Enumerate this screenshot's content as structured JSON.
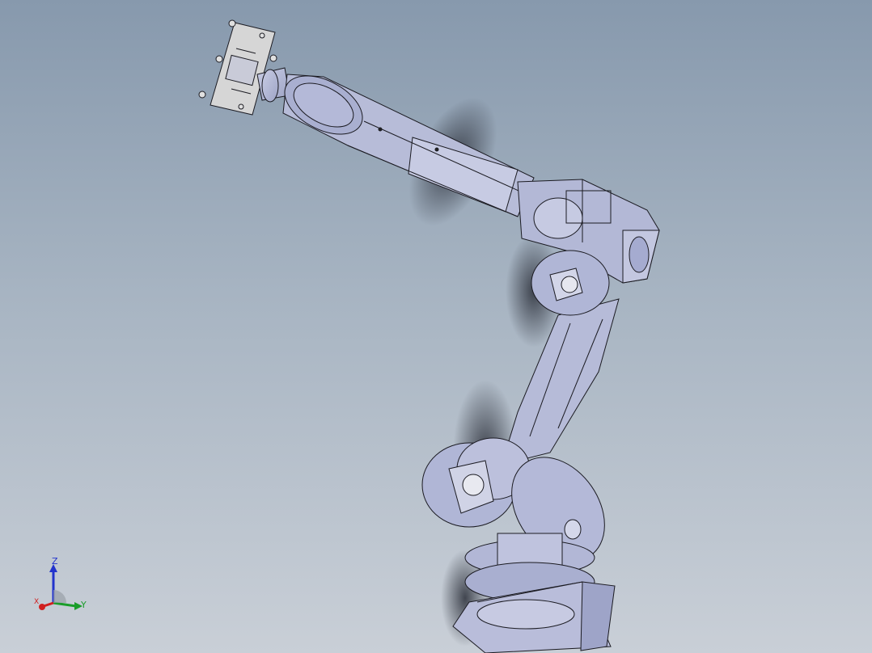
{
  "triad": {
    "z_label": "Z",
    "y_label": "Y",
    "x_label": "X"
  },
  "colors": {
    "background_top": "#8799ad",
    "background_bottom": "#c9cfd7",
    "part_fill": "#b8bdd8",
    "edge_line": "#1b1b22",
    "plate_fill": "#d4d4d4",
    "axis_z": "#2233cc",
    "axis_y": "#1a9d2a",
    "axis_x": "#d02020"
  },
  "icons": [
    "triad-icon",
    "robot-arm-model"
  ]
}
